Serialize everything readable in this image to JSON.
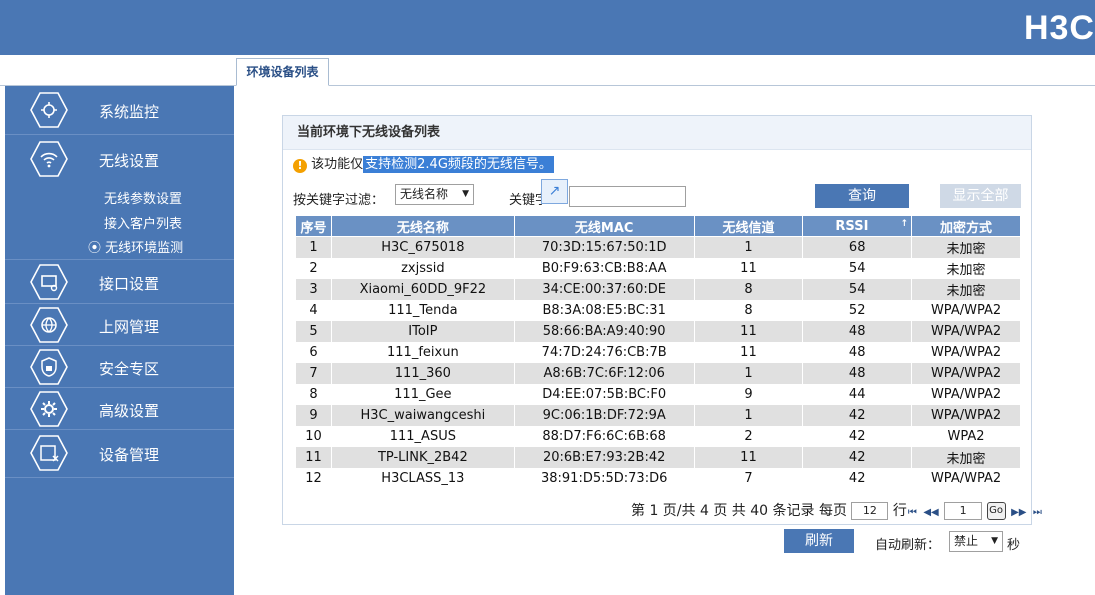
{
  "header": {
    "logo": "H3C"
  },
  "tab": {
    "label": "环境设备列表"
  },
  "sidebar": {
    "items": [
      {
        "label": "系统监控",
        "icon": "monitor-gear-icon"
      },
      {
        "label": "无线设置",
        "icon": "wifi-icon"
      },
      {
        "label": "接口设置",
        "icon": "interface-icon"
      },
      {
        "label": "上网管理",
        "icon": "globe-icon"
      },
      {
        "label": "安全专区",
        "icon": "shield-lock-icon"
      },
      {
        "label": "高级设置",
        "icon": "gear-icon"
      },
      {
        "label": "设备管理",
        "icon": "device-manage-icon"
      }
    ],
    "subitems": [
      {
        "label": "无线参数设置"
      },
      {
        "label": "接入客户列表"
      },
      {
        "label": "无线环境监测",
        "active": true
      }
    ],
    "active_marker": "⦿"
  },
  "panel": {
    "title": "当前环境下无线设备列表",
    "notice_plain": "该功能仅",
    "notice_selected": "支持检测2.4G频段的无线信号。",
    "filter_label": "按关键字过滤：",
    "filter_value": "无线名称",
    "keyword_label": "关键字：",
    "query_button": "查询",
    "show_all_button": "显示全部"
  },
  "table": {
    "columns": [
      "序号",
      "无线名称",
      "无线MAC",
      "无线信道",
      "RSSI",
      "加密方式"
    ],
    "sort_mark": "↑",
    "rows": [
      [
        "1",
        "H3C_675018",
        "70:3D:15:67:50:1D",
        "1",
        "68",
        "未加密"
      ],
      [
        "2",
        "zxjssid",
        "B0:F9:63:CB:B8:AA",
        "11",
        "54",
        "未加密"
      ],
      [
        "3",
        "Xiaomi_60DD_9F22",
        "34:CE:00:37:60:DE",
        "8",
        "54",
        "未加密"
      ],
      [
        "4",
        "111_Tenda",
        "B8:3A:08:E5:BC:31",
        "8",
        "52",
        "WPA/WPA2"
      ],
      [
        "5",
        "IToIP",
        "58:66:BA:A9:40:90",
        "11",
        "48",
        "WPA/WPA2"
      ],
      [
        "6",
        "111_feixun",
        "74:7D:24:76:CB:7B",
        "11",
        "48",
        "WPA/WPA2"
      ],
      [
        "7",
        "111_360",
        "A8:6B:7C:6F:12:06",
        "1",
        "48",
        "WPA/WPA2"
      ],
      [
        "8",
        "111_Gee",
        "D4:EE:07:5B:BC:F0",
        "9",
        "44",
        "WPA/WPA2"
      ],
      [
        "9",
        "H3C_waiwangceshi",
        "9C:06:1B:DF:72:9A",
        "1",
        "42",
        "WPA/WPA2"
      ],
      [
        "10",
        "111_ASUS",
        "88:D7:F6:6C:6B:68",
        "2",
        "42",
        "WPA2"
      ],
      [
        "11",
        "TP-LINK_2B42",
        "20:6B:E7:93:2B:42",
        "11",
        "42",
        "未加密"
      ],
      [
        "12",
        "H3CLASS_13",
        "38:91:D5:5D:73:D6",
        "7",
        "42",
        "WPA/WPA2"
      ]
    ]
  },
  "pager": {
    "summary": "第 1 页/共 4 页 共 40 条记录 每页",
    "per_page": "12",
    "row_unit": "行",
    "first": "⏮",
    "prev": "◀◀",
    "page": "1",
    "go": "Go",
    "next": "▶▶",
    "last": "⏭"
  },
  "footer": {
    "refresh_button": "刷新",
    "auto_label": "自动刷新：",
    "auto_value": "禁止",
    "auto_unit": "秒"
  },
  "colors": {
    "brand": "#4a77b4",
    "header_cell": "#6a91c4",
    "selection": "#3b7fd6",
    "warn": "#f4a000"
  }
}
